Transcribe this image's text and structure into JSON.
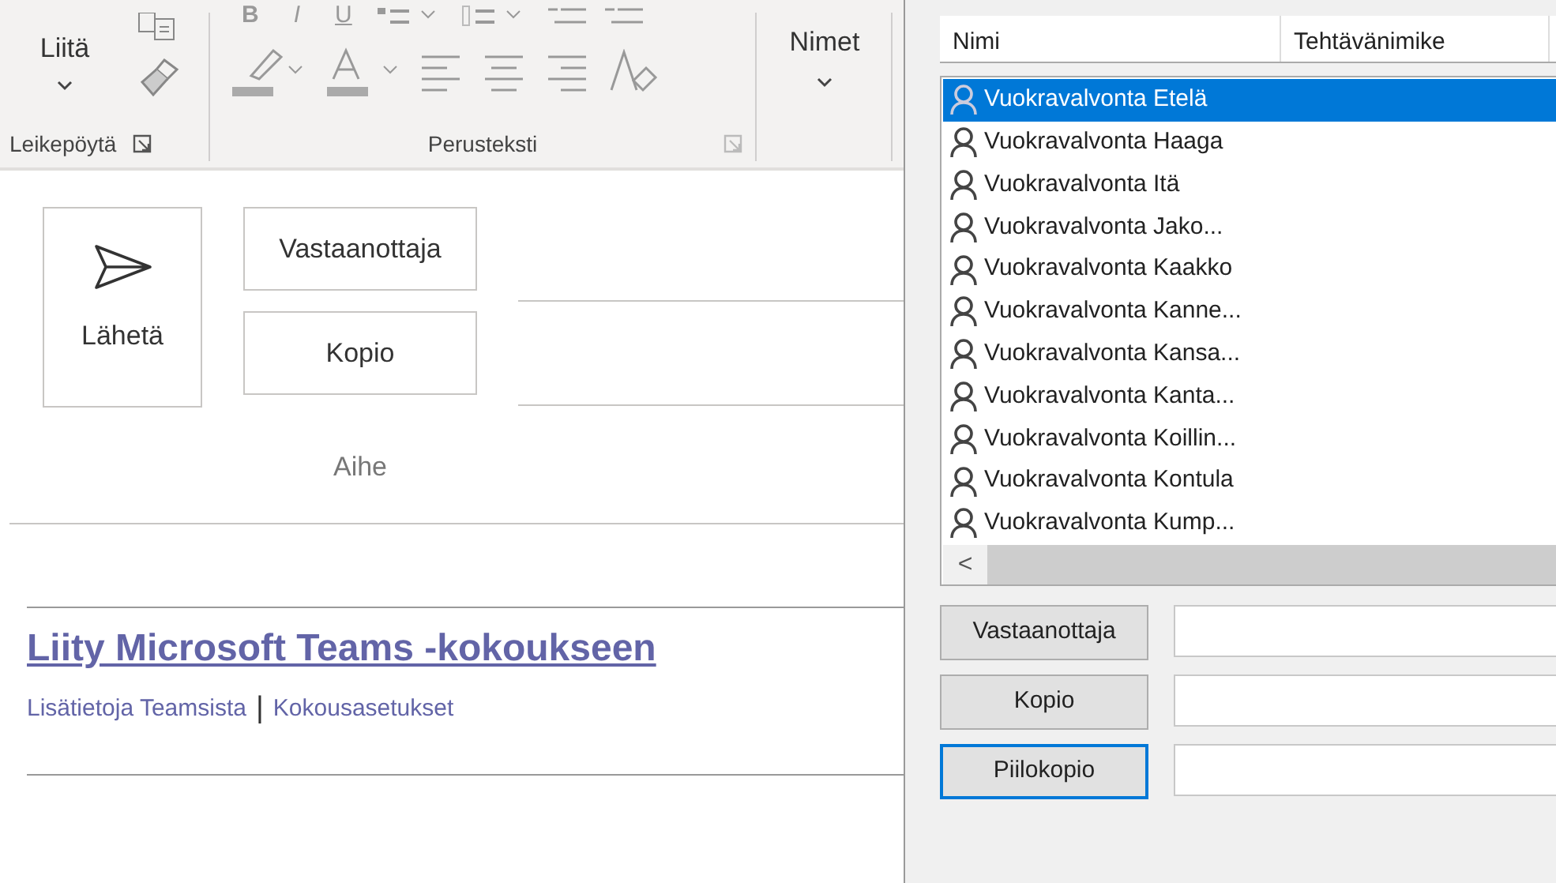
{
  "ribbon": {
    "clipboard": {
      "paste_label": "Liitä",
      "group_label": "Leikepöytä"
    },
    "basic_text": {
      "format_buttons": [
        "B",
        "I",
        "U"
      ],
      "group_label": "Perusteksti"
    },
    "names_label": "Nimet"
  },
  "compose": {
    "send_label": "Lähetä",
    "to_label": "Vastaanottaja",
    "cc_label": "Kopio",
    "subject_label": "Aihe",
    "meeting": {
      "join_link": "Liity Microsoft Teams -kokoukseen",
      "info_link": "Lisätietoja Teamsista",
      "separator": "|",
      "options_link": "Kokousasetukset"
    }
  },
  "address_book": {
    "columns": [
      "Nimi",
      "Tehtävänimike"
    ],
    "contacts": [
      {
        "name": "Vuokravalvonta Etelä",
        "selected": true
      },
      {
        "name": "Vuokravalvonta Haaga",
        "selected": false
      },
      {
        "name": "Vuokravalvonta Itä",
        "selected": false
      },
      {
        "name": "Vuokravalvonta Jako...",
        "selected": false
      },
      {
        "name": "Vuokravalvonta Kaakko",
        "selected": false
      },
      {
        "name": "Vuokravalvonta Kanne...",
        "selected": false
      },
      {
        "name": "Vuokravalvonta Kansa...",
        "selected": false
      },
      {
        "name": "Vuokravalvonta Kanta...",
        "selected": false
      },
      {
        "name": "Vuokravalvonta Koillin...",
        "selected": false
      },
      {
        "name": "Vuokravalvonta Kontula",
        "selected": false
      },
      {
        "name": "Vuokravalvonta Kump...",
        "selected": false
      }
    ],
    "scroll_left": "<",
    "recipient_buttons": [
      {
        "label": "Vastaanottaja",
        "focused": false
      },
      {
        "label": "Kopio",
        "focused": false
      },
      {
        "label": "Piilokopio",
        "focused": true
      }
    ]
  }
}
